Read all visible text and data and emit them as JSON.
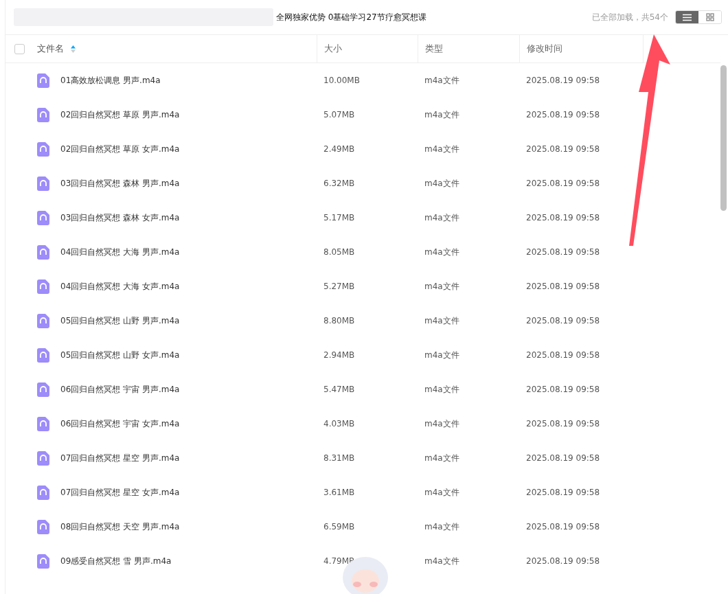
{
  "title": "全网独家优势 0基础学习27节疗愈冥想课",
  "status": "已全部加载，共54个",
  "view_buttons": [
    {
      "kind": "list",
      "selected": true
    },
    {
      "kind": "grid",
      "selected": false
    }
  ],
  "select_all": {
    "checked": false
  },
  "columns": [
    {
      "label": "文件名",
      "sorted": true
    },
    {
      "label": "大小",
      "sorted": false
    },
    {
      "label": "类型",
      "sorted": false
    },
    {
      "label": "修改时间",
      "sorted": false
    }
  ],
  "rows": [
    {
      "name": "01高效放松调息 男声.m4a",
      "size": "10.00MB",
      "type": "m4a文件",
      "modified": "2025.08.19 09:58"
    },
    {
      "name": "02回归自然冥想 草原 男声.m4a",
      "size": "5.07MB",
      "type": "m4a文件",
      "modified": "2025.08.19 09:58"
    },
    {
      "name": "02回归自然冥想 草原 女声.m4a",
      "size": "2.49MB",
      "type": "m4a文件",
      "modified": "2025.08.19 09:58"
    },
    {
      "name": "03回归自然冥想 森林 男声.m4a",
      "size": "6.32MB",
      "type": "m4a文件",
      "modified": "2025.08.19 09:58"
    },
    {
      "name": "03回归自然冥想 森林 女声.m4a",
      "size": "5.17MB",
      "type": "m4a文件",
      "modified": "2025.08.19 09:58"
    },
    {
      "name": "04回归自然冥想 大海 男声.m4a",
      "size": "8.05MB",
      "type": "m4a文件",
      "modified": "2025.08.19 09:58"
    },
    {
      "name": "04回归自然冥想 大海 女声.m4a",
      "size": "5.27MB",
      "type": "m4a文件",
      "modified": "2025.08.19 09:58"
    },
    {
      "name": "05回归自然冥想 山野 男声.m4a",
      "size": "8.80MB",
      "type": "m4a文件",
      "modified": "2025.08.19 09:58"
    },
    {
      "name": "05回归自然冥想 山野 女声.m4a",
      "size": "2.94MB",
      "type": "m4a文件",
      "modified": "2025.08.19 09:58"
    },
    {
      "name": "06回归自然冥想 宇宙 男声.m4a",
      "size": "5.47MB",
      "type": "m4a文件",
      "modified": "2025.08.19 09:58"
    },
    {
      "name": "06回归自然冥想 宇宙 女声.m4a",
      "size": "4.03MB",
      "type": "m4a文件",
      "modified": "2025.08.19 09:58"
    },
    {
      "name": "07回归自然冥想 星空 男声.m4a",
      "size": "8.31MB",
      "type": "m4a文件",
      "modified": "2025.08.19 09:58"
    },
    {
      "name": "07回归自然冥想 星空 女声.m4a",
      "size": "3.61MB",
      "type": "m4a文件",
      "modified": "2025.08.19 09:58"
    },
    {
      "name": "08回归自然冥想 天空 男声.m4a",
      "size": "6.59MB",
      "type": "m4a文件",
      "modified": "2025.08.19 09:58"
    },
    {
      "name": "09感受自然冥想 雪 男声.m4a",
      "size": "4.79MB",
      "type": "m4a文件",
      "modified": "2025.08.19 09:58"
    }
  ]
}
